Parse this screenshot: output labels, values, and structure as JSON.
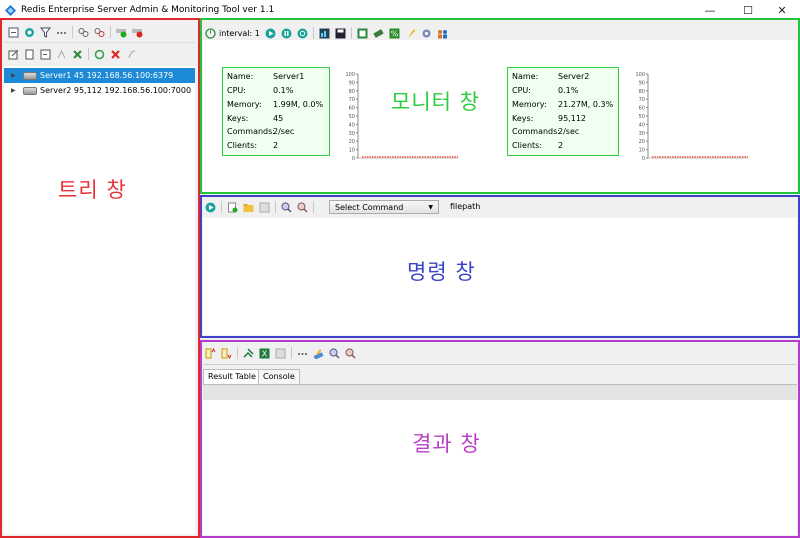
{
  "window": {
    "title": "Redis Enterprise Server Admin & Monitoring Tool ver 1.1",
    "controls": {
      "minimize": "—",
      "maximize": "☐",
      "close": "✕"
    }
  },
  "tree": {
    "region_label": "트리 창",
    "servers": [
      {
        "label": "Server1 45 192.168.56.100:6379",
        "selected": true
      },
      {
        "label": "Server2 95,112 192.168.56.100:7000",
        "selected": false
      }
    ]
  },
  "monitor": {
    "region_label": "모니터 창",
    "interval_label": "interval: 1",
    "stat_labels": {
      "name": "Name:",
      "cpu": "CPU:",
      "memory": "Memory:",
      "keys": "Keys:",
      "commands": "Commands:",
      "clients": "Clients:"
    },
    "servers": [
      {
        "name": "Server1",
        "cpu": "0.1%",
        "memory": "1.99M, 0.0%",
        "keys": "45",
        "commands": "2/sec",
        "clients": "2"
      },
      {
        "name": "Server2",
        "cpu": "0.1%",
        "memory": "21.27M, 0.3%",
        "keys": "95,112",
        "commands": "2/sec",
        "clients": "2"
      }
    ],
    "axis_ticks": [
      "100",
      "90",
      "80",
      "70",
      "60",
      "50",
      "40",
      "30",
      "20",
      "10",
      "0"
    ]
  },
  "command": {
    "region_label": "명령 창",
    "select_value": "Select Command",
    "filepath_label": "filepath"
  },
  "result": {
    "region_label": "결과 창",
    "tabs": [
      "Result Table",
      "Console"
    ]
  },
  "colors": {
    "tree_outline": "#e0262e",
    "tree_label": "#e8313a",
    "monitor_outline": "#22c43c",
    "monitor_label": "#2ecc40",
    "command_outline": "#4040c8",
    "command_label": "#3a44c8",
    "result_outline": "#b43cc8",
    "result_label": "#b93ec8",
    "selection": "#1c8ad6"
  }
}
